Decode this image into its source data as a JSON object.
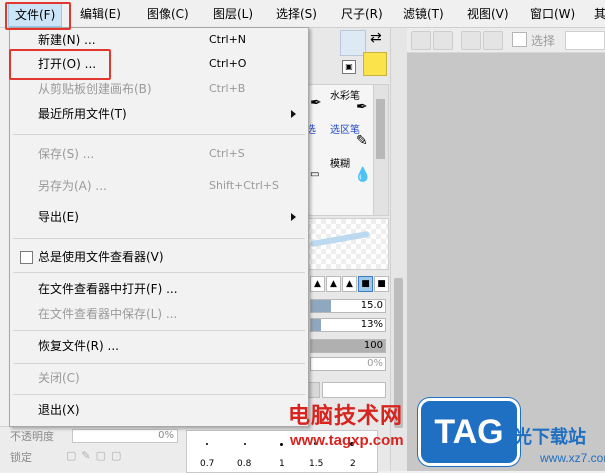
{
  "menubar": {
    "items": [
      {
        "label": "文件(F)"
      },
      {
        "label": "编辑(E)"
      },
      {
        "label": "图像(C)"
      },
      {
        "label": "图层(L)"
      },
      {
        "label": "选择(S)"
      },
      {
        "label": "尺子(R)"
      },
      {
        "label": "滤镜(T)"
      },
      {
        "label": "视图(V)"
      },
      {
        "label": "窗口(W)"
      },
      {
        "label": "其"
      }
    ]
  },
  "file_menu": {
    "items": [
      {
        "label": "新建(N) ...",
        "shortcut": "Ctrl+N",
        "enabled": true
      },
      {
        "label": "打开(O) ...",
        "shortcut": "Ctrl+O",
        "enabled": true,
        "highlighted": true
      },
      {
        "label": "从剪贴板创建画布(B)",
        "shortcut": "Ctrl+B",
        "enabled": false
      },
      {
        "label": "最近所用文件(T)",
        "shortcut": "",
        "enabled": true,
        "submenu": true
      },
      {
        "label": "保存(S) ...",
        "shortcut": "Ctrl+S",
        "enabled": false
      },
      {
        "label": "另存为(A) ...",
        "shortcut": "Shift+Ctrl+S",
        "enabled": false
      },
      {
        "label": "导出(E)",
        "shortcut": "",
        "enabled": true,
        "submenu": true
      },
      {
        "label": "总是使用文件查看器(V)",
        "shortcut": "",
        "enabled": true,
        "checkbox": true,
        "checked": false
      },
      {
        "label": "在文件查看器中打开(F) ...",
        "shortcut": "",
        "enabled": true
      },
      {
        "label": "在文件查看器中保存(L) ...",
        "shortcut": "",
        "enabled": false
      },
      {
        "label": "恢复文件(R) ...",
        "shortcut": "",
        "enabled": true
      },
      {
        "label": "关闭(C)",
        "shortcut": "",
        "enabled": false
      },
      {
        "label": "退出(X)",
        "shortcut": "",
        "enabled": true
      }
    ]
  },
  "toolbar": {
    "select_label": "选择"
  },
  "tools": {
    "watercolor_label": "水彩笔",
    "select_pen_label": "选区笔",
    "blur_label": "模糊"
  },
  "sliders": {
    "size_value": "15.0",
    "density_value": "13%",
    "third_value": "100",
    "fourth_value": "0%"
  },
  "layer_panel": {
    "opacity_label": "不透明度",
    "opacity_value": "0%",
    "lock_label": "锁定"
  },
  "brush_sizes": [
    "0.7",
    "0.8",
    "1",
    "1.5",
    "2"
  ],
  "watermark": {
    "site_name": "电脑技术网",
    "site_url": "www.tagxp.com",
    "logo_text": "TAG",
    "sub_name": "光下载站",
    "sub_url": "www.xz7.com"
  },
  "colors": {
    "highlight_red": "#e2372f",
    "menu_active_bg": "#cce4f7",
    "primary_color": "#dde9f5",
    "secondary_color": "#fbe34c"
  }
}
